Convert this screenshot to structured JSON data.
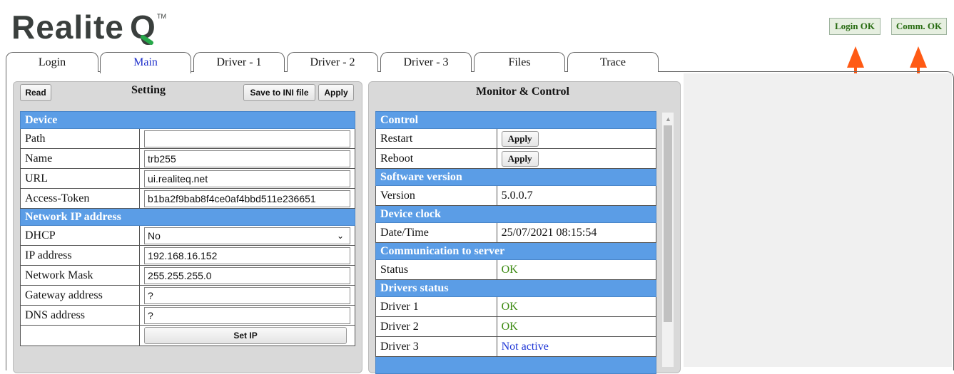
{
  "brand": {
    "name": "RealiteQ",
    "tm": "TM"
  },
  "status": {
    "login": "Login OK",
    "comm": "Comm. OK"
  },
  "colors": {
    "arrow": "#ff5a14",
    "section": "#5b9de6",
    "ok": "#3c8a12",
    "not_active": "#1d35d6"
  },
  "tabs": [
    "Login",
    "Main",
    "Driver - 1",
    "Driver - 2",
    "Driver - 3",
    "Files",
    "Trace"
  ],
  "setting": {
    "read_label": "Read",
    "title": "Setting",
    "save_label": "Save to INI file",
    "apply_label": "Apply",
    "device_section": "Device",
    "path_label": "Path",
    "path_value": "",
    "name_label": "Name",
    "name_value": "trb255",
    "url_label": "URL",
    "url_value": "ui.realiteq.net",
    "token_label": "Access-Token",
    "token_value": "b1ba2f9bab8f4ce0af4bbd511e236651",
    "network_section": "Network IP address",
    "dhcp_label": "DHCP",
    "dhcp_value": "No",
    "ip_label": "IP address",
    "ip_value": "192.168.16.152",
    "mask_label": "Network Mask",
    "mask_value": "255.255.255.0",
    "gateway_label": "Gateway address",
    "gateway_value": "?",
    "dns_label": "DNS address",
    "dns_value": "?",
    "setip_label": "Set IP"
  },
  "monitor": {
    "title": "Monitor & Control",
    "control_section": "Control",
    "restart_label": "Restart",
    "reboot_label": "Reboot",
    "apply_label": "Apply",
    "software_section": "Software version",
    "version_label": "Version",
    "version_value": "5.0.0.7",
    "clock_section": "Device clock",
    "datetime_label": "Date/Time",
    "datetime_value": "25/07/2021 08:15:54",
    "comm_section": "Communication to server",
    "status_label": "Status",
    "status_value": "OK",
    "drivers_section": "Drivers status",
    "driver1_label": "Driver 1",
    "driver1_value": "OK",
    "driver2_label": "Driver 2",
    "driver2_value": "OK",
    "driver3_label": "Driver 3",
    "driver3_value": "Not active"
  }
}
